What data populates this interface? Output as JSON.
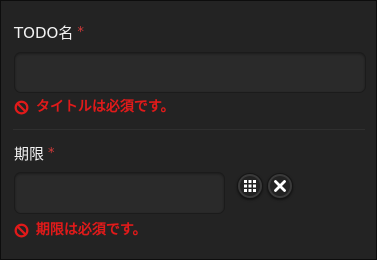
{
  "form": {
    "todo_name": {
      "label": "TODO名",
      "required_mark": "*",
      "value": "",
      "error": "タイトルは必須です。"
    },
    "deadline": {
      "label": "期限",
      "required_mark": "*",
      "value": "",
      "error": "期限は必須です。"
    }
  },
  "icons": {
    "error": "prohibited-icon",
    "calendar": "calendar-grid-icon",
    "clear": "close-icon"
  },
  "colors": {
    "background": "#232323",
    "error": "#e11a1a",
    "required": "#d63a3a",
    "label": "#f2f2f2"
  }
}
